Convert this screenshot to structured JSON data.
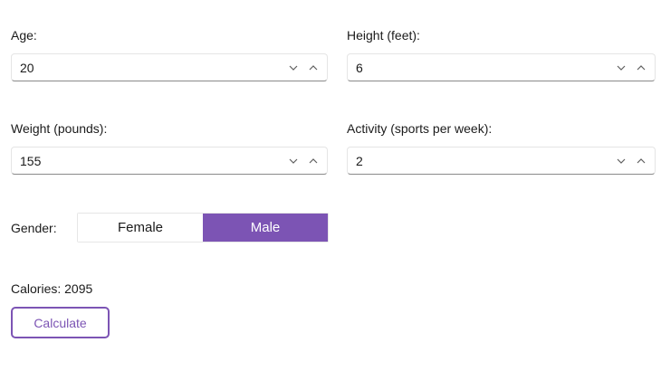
{
  "age": {
    "label": "Age:",
    "value": "20"
  },
  "height": {
    "label": "Height (feet):",
    "value": "6"
  },
  "weight": {
    "label": "Weight (pounds):",
    "value": "155"
  },
  "activity": {
    "label": "Activity (sports per week):",
    "value": "2"
  },
  "gender": {
    "label": "Gender:",
    "options": [
      "Female",
      "Male"
    ],
    "selected": "Male"
  },
  "result": {
    "text": "Calories: 2095"
  },
  "calculate": {
    "label": "Calculate"
  },
  "icons": {
    "spin_down": "chevron-down-icon",
    "spin_up": "chevron-up-icon"
  },
  "colors": {
    "accent": "#7c54b4",
    "text": "#1b1b1b",
    "icon": "#5f5f5f"
  }
}
